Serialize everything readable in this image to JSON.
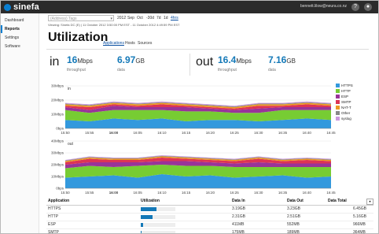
{
  "app": {
    "name": "sinefa",
    "user": "bennett.lilow@neura.co.nz"
  },
  "topbar_icons": [
    "question-icon",
    "user-icon"
  ],
  "sidebar": {
    "items": [
      {
        "label": "Dashboard",
        "active": false
      },
      {
        "label": "Reports",
        "active": true
      },
      {
        "label": "Settings",
        "active": false
      },
      {
        "label": "Software",
        "active": false
      }
    ]
  },
  "filter": {
    "placeholder": "(Address) Tags"
  },
  "ranges": [
    "2012",
    "Sep",
    "Oct",
    "-30d",
    "7d",
    "1d",
    "4hrs"
  ],
  "selected_range": "4hrs",
  "viewing": "Viewing: Sinefa DC (E) | 11 October 2012 3:50:00 PM EST - 11 October 2012 4:49:59 PM EST",
  "title": "Utilization",
  "subtabs": [
    "Applications",
    "Hosts",
    "Sources"
  ],
  "selected_subtab": "Applications",
  "summary": {
    "in": {
      "label": "in",
      "throughput": "16",
      "throughput_unit": "Mbps",
      "throughput_caption": "throughput",
      "data": "6.97",
      "data_unit": "GB",
      "data_caption": "data"
    },
    "out": {
      "label": "out",
      "throughput": "16.4",
      "throughput_unit": "Mbps",
      "throughput_caption": "throughput",
      "data": "7.16",
      "data_unit": "GB",
      "data_caption": "data"
    }
  },
  "chart_data": [
    {
      "type": "area",
      "title": "in",
      "x": [
        "15:50",
        "15:55",
        "16:00",
        "16:05",
        "16:10",
        "16:15",
        "16:20",
        "16:25",
        "16:30",
        "16:35",
        "16:40",
        "16:45"
      ],
      "yticks": [
        "0bps",
        "10Mbps",
        "20Mbps",
        "30Mbps"
      ],
      "ylim": [
        0,
        30
      ],
      "series": [
        {
          "name": "HTTPS",
          "color": "#3399dd",
          "values": [
            6,
            5,
            7,
            6,
            7,
            5,
            6,
            6,
            5,
            6,
            7,
            6
          ]
        },
        {
          "name": "HTTP",
          "color": "#77cc33",
          "values": [
            7,
            6,
            6,
            7,
            6,
            7,
            6,
            5,
            6,
            7,
            6,
            7
          ]
        },
        {
          "name": "ESP",
          "color": "#993399",
          "values": [
            2,
            2,
            3,
            2,
            2,
            3,
            2,
            2,
            3,
            2,
            2,
            2
          ]
        },
        {
          "name": "SMTP",
          "color": "#dd3355",
          "values": [
            1,
            2,
            1,
            1,
            2,
            1,
            1,
            1,
            2,
            1,
            2,
            1
          ]
        },
        {
          "name": "NAT-T",
          "color": "#ee9922",
          "values": [
            1,
            1,
            1,
            1,
            1,
            1,
            1,
            1,
            1,
            1,
            1,
            1
          ]
        },
        {
          "name": "Other",
          "color": "#888888",
          "values": [
            0.5,
            0.5,
            0.5,
            0.5,
            0.5,
            0.5,
            0.5,
            0.5,
            0.5,
            0.5,
            0.5,
            0.5
          ]
        },
        {
          "name": "syslog",
          "color": "#cc99dd",
          "values": [
            0.5,
            0.5,
            0.5,
            0.5,
            0.5,
            0.5,
            0.5,
            0.5,
            0.5,
            0.5,
            0.5,
            0.5
          ]
        }
      ]
    },
    {
      "type": "area",
      "title": "out",
      "x": [
        "15:50",
        "15:55",
        "16:00",
        "16:05",
        "16:10",
        "16:15",
        "16:20",
        "16:25",
        "16:30",
        "16:35",
        "16:40",
        "16:45"
      ],
      "yticks": [
        "0bps",
        "10Mbps",
        "20Mbps",
        "30Mbps",
        "40Mbps"
      ],
      "ylim": [
        0,
        40
      ],
      "series": [
        {
          "name": "HTTPS",
          "color": "#3399dd",
          "values": [
            9,
            10,
            11,
            9,
            12,
            10,
            11,
            9,
            10,
            11,
            9,
            10
          ]
        },
        {
          "name": "HTTP",
          "color": "#77cc33",
          "values": [
            8,
            9,
            7,
            10,
            8,
            9,
            8,
            9,
            8,
            7,
            9,
            8
          ]
        },
        {
          "name": "ESP",
          "color": "#993399",
          "values": [
            3,
            3,
            4,
            3,
            3,
            4,
            3,
            3,
            4,
            3,
            3,
            3
          ]
        },
        {
          "name": "SMTP",
          "color": "#dd3355",
          "values": [
            2,
            3,
            2,
            2,
            3,
            2,
            2,
            2,
            3,
            2,
            3,
            2
          ]
        },
        {
          "name": "NAT-T",
          "color": "#ee9922",
          "values": [
            1,
            1,
            1,
            1,
            1,
            1,
            1,
            1,
            1,
            1,
            1,
            1
          ]
        },
        {
          "name": "Other",
          "color": "#888888",
          "values": [
            0.5,
            0.5,
            0.5,
            0.5,
            0.5,
            0.5,
            0.5,
            0.5,
            0.5,
            0.5,
            0.5,
            0.5
          ]
        },
        {
          "name": "syslog",
          "color": "#cc99dd",
          "values": [
            0.5,
            0.5,
            0.5,
            0.5,
            0.5,
            0.5,
            0.5,
            0.5,
            0.5,
            0.5,
            0.5,
            0.5
          ]
        }
      ]
    }
  ],
  "table": {
    "headers": [
      "Application",
      "Utilization",
      "Data In",
      "Data Out",
      "Data Total"
    ],
    "rows": [
      {
        "app": "HTTPS",
        "util": 0.46,
        "data_in": "3.19GB",
        "data_out": "3.23GB",
        "total": "6.45GB"
      },
      {
        "app": "HTTP",
        "util": 0.35,
        "data_in": "2.31GB",
        "data_out": "2.51GB",
        "total": "5.16GB"
      },
      {
        "app": "ESP",
        "util": 0.07,
        "data_in": "411MB",
        "data_out": "552MB",
        "total": "966MB"
      },
      {
        "app": "SMTP",
        "util": 0.03,
        "data_in": "175MB",
        "data_out": "189MB",
        "total": "364MB"
      }
    ]
  }
}
